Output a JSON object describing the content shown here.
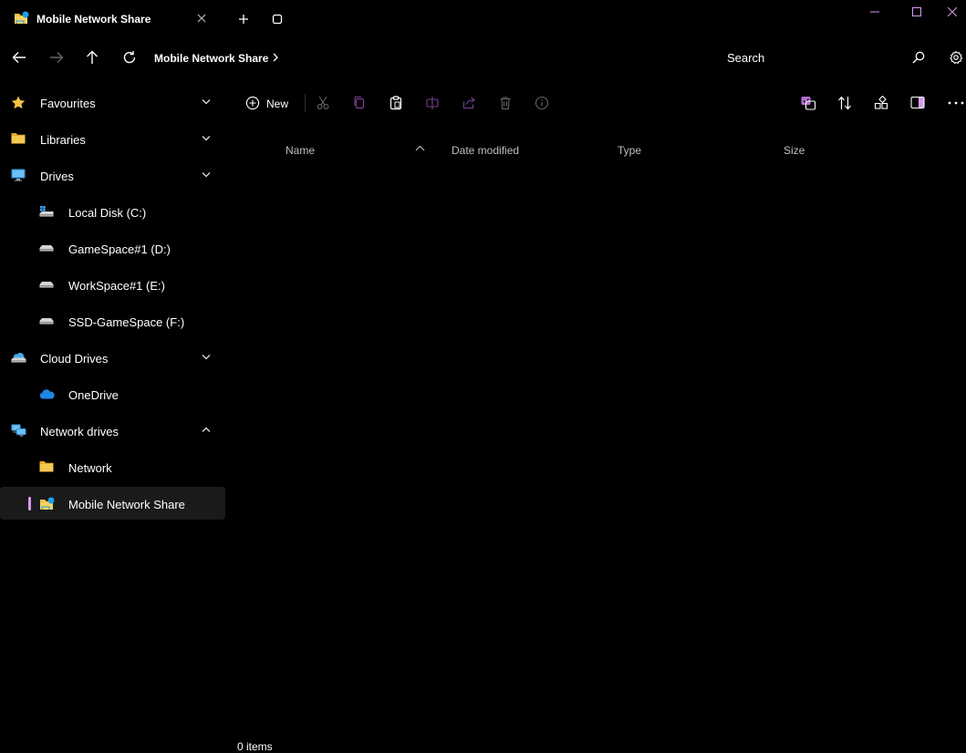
{
  "tab": {
    "title": "Mobile Network Share"
  },
  "address": {
    "crumb": "Mobile Network Share"
  },
  "search": {
    "placeholder": "Search"
  },
  "toolbar": {
    "new_label": "New"
  },
  "columns": {
    "name": "Name",
    "date_modified": "Date modified",
    "type": "Type",
    "size": "Size"
  },
  "sidebar": {
    "items": [
      {
        "label": "Favourites",
        "level": "top",
        "icon": "star-icon",
        "expand": "chevron-down"
      },
      {
        "label": "Libraries",
        "level": "top",
        "icon": "folder-icon",
        "expand": "chevron-down"
      },
      {
        "label": "Drives",
        "level": "top",
        "icon": "monitor-icon",
        "expand": "chevron-down"
      },
      {
        "label": "Local Disk (C:)",
        "level": "child",
        "icon": "windows-drive-icon"
      },
      {
        "label": "GameSpace#1 (D:)",
        "level": "child",
        "icon": "drive-icon"
      },
      {
        "label": "WorkSpace#1 (E:)",
        "level": "child",
        "icon": "drive-icon"
      },
      {
        "label": "SSD-GameSpace (F:)",
        "level": "child",
        "icon": "drive-icon"
      },
      {
        "label": "Cloud Drives",
        "level": "top",
        "icon": "cloud-drive-icon",
        "expand": "chevron-down"
      },
      {
        "label": "OneDrive",
        "level": "child",
        "icon": "onedrive-cloud-icon"
      },
      {
        "label": "Network drives",
        "level": "top",
        "icon": "network-icon",
        "expand": "chevron-up"
      },
      {
        "label": "Network",
        "level": "child",
        "icon": "folder-icon"
      },
      {
        "label": "Mobile Network Share",
        "level": "child",
        "icon": "network-share-icon",
        "selected": true
      }
    ]
  },
  "status": {
    "text": "0 items"
  },
  "colors": {
    "accent": "#d79cf0",
    "folder": "#f3c64a",
    "star": "#f6c344",
    "onedrive": "#1e88e5"
  }
}
